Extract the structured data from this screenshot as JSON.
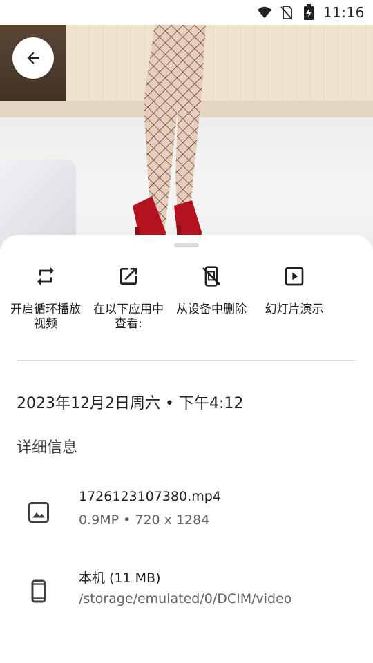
{
  "status_bar": {
    "time": "11:16"
  },
  "actions": [
    {
      "label": "开启循环播放视频",
      "icon": "repeat-icon"
    },
    {
      "label": "在以下应用中查看:",
      "icon": "open-external-icon"
    },
    {
      "label": "从设备中删除",
      "icon": "delete-from-device-icon"
    },
    {
      "label": "幻灯片演示",
      "icon": "slideshow-icon"
    }
  ],
  "date_line": "2023年12月2日周六 • 下午4:12",
  "details_title": "详细信息",
  "file_info": {
    "name": "1726123107380.mp4",
    "meta": "0.9MP  •  720 x 1284"
  },
  "storage_info": {
    "location": "本机 (11 MB)",
    "path": "/storage/emulated/0/DCIM/video"
  },
  "colors": {
    "sheet": "#ffffff",
    "icon": "#202124",
    "secondary_text": "#5f6368",
    "shoe_red": "#b3121f"
  }
}
